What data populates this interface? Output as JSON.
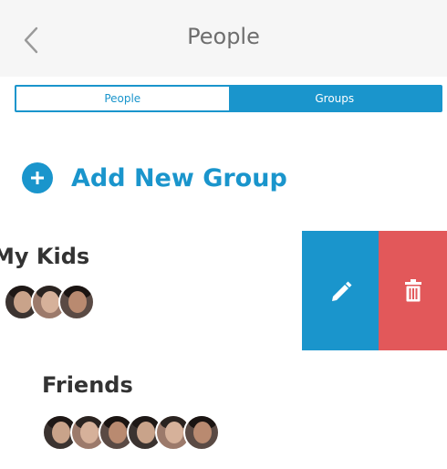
{
  "header": {
    "title": "People",
    "back_icon": "chevron-left-icon"
  },
  "segmented": {
    "tabs": [
      {
        "label": "People",
        "active": false
      },
      {
        "label": "Groups",
        "active": true
      }
    ]
  },
  "add_group": {
    "label": "Add New Group",
    "icon": "plus-circle-icon"
  },
  "groups": [
    {
      "name": "My Kids",
      "member_avatars": 3,
      "swiped_actions": [
        {
          "icon": "pencil-icon",
          "color": "#1a95cc"
        },
        {
          "icon": "trash-icon",
          "color": "#e2585a"
        }
      ]
    },
    {
      "name": "Friends",
      "member_avatars": 6
    }
  ],
  "colors": {
    "accent": "#1a95cc",
    "delete": "#e2585a",
    "header_bg": "#f6f6f6"
  }
}
